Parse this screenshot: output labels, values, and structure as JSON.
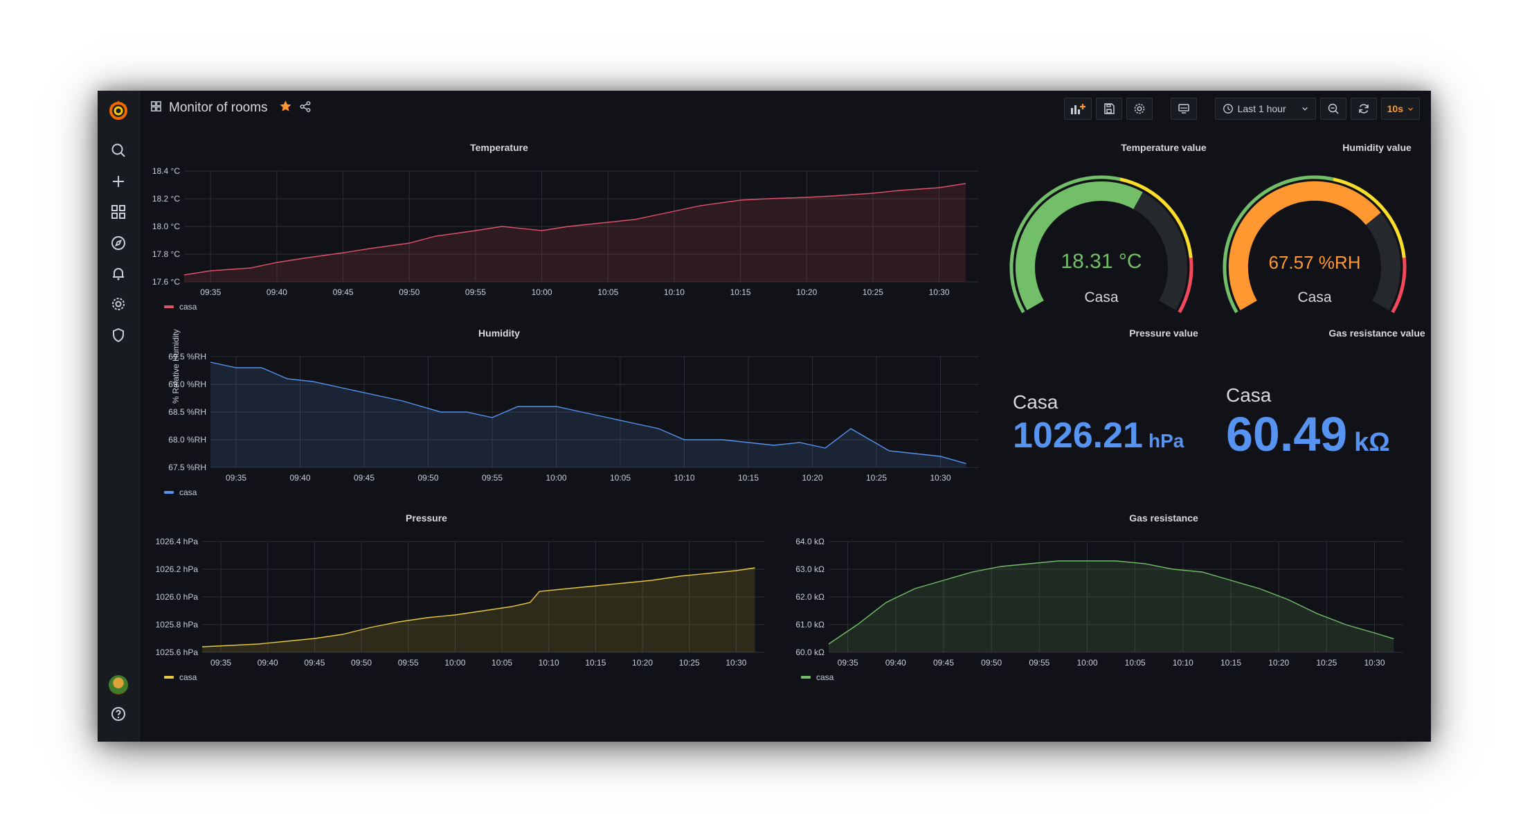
{
  "dashboard": {
    "title": "Monitor of rooms",
    "starred": true
  },
  "icons": {
    "logo": "grafana-logo-icon",
    "dashboard_grid": "dashboard-grid-icon",
    "star": "star-icon",
    "share": "share-icon",
    "sidebar": [
      "search-icon",
      "plus-icon",
      "dashboards-icon",
      "explore-icon",
      "alerting-bell-icon",
      "gear-icon",
      "shield-icon"
    ],
    "help": "help-icon"
  },
  "toolbar": {
    "time_range": "Last 1 hour",
    "refresh_interval": "10s",
    "buttons": [
      "add-panel-icon",
      "save-icon",
      "gear-icon",
      "tv-mode-icon",
      "clock-icon",
      "zoom-out-icon",
      "refresh-icon"
    ]
  },
  "colors": {
    "temperature": "#e0526c",
    "humidity": "#5794f2",
    "pressure": "#e8c83c",
    "gas": "#73bf69",
    "gauge_green": "#73bf69",
    "gauge_orange": "#ff9830",
    "gauge_yellow": "#fade2a",
    "gauge_red": "#f2495c",
    "stat_blue": "#5794f2"
  },
  "panels": {
    "temperature": {
      "title": "Temperature",
      "legend": "casa"
    },
    "humidity": {
      "title": "Humidity",
      "legend": "casa"
    },
    "pressure": {
      "title": "Pressure",
      "legend": "casa"
    },
    "gas": {
      "title": "Gas resistance",
      "legend": "casa"
    },
    "temperature_gauge": {
      "title": "Temperature value",
      "value": "18.31 °C",
      "label": "Casa",
      "fraction": 0.62
    },
    "humidity_gauge": {
      "title": "Humidity value",
      "value": "67.57 %RH",
      "label": "Casa",
      "fraction": 0.71
    },
    "pressure_stat": {
      "title": "Pressure value",
      "name": "Casa",
      "value": "1026.21",
      "unit": "hPa"
    },
    "gas_stat": {
      "title": "Gas resistance value",
      "name": "Casa",
      "value": "60.49",
      "unit": "kΩ"
    }
  },
  "chart_data": [
    {
      "type": "area",
      "title": "Temperature",
      "ylabel": "",
      "y_ticks": [
        "18.4 °C",
        "18.2 °C",
        "18.0 °C",
        "17.8 °C",
        "17.6 °C"
      ],
      "ylim": [
        17.6,
        18.4
      ],
      "x_ticks": [
        "09:35",
        "09:40",
        "09:45",
        "09:50",
        "09:55",
        "10:00",
        "10:05",
        "10:10",
        "10:15",
        "10:20",
        "10:25",
        "10:30"
      ],
      "x": [
        "09:33",
        "09:35",
        "09:38",
        "09:40",
        "09:42",
        "09:45",
        "09:47",
        "09:50",
        "09:52",
        "09:55",
        "09:57",
        "10:00",
        "10:02",
        "10:05",
        "10:07",
        "10:10",
        "10:12",
        "10:15",
        "10:17",
        "10:20",
        "10:22",
        "10:25",
        "10:27",
        "10:30",
        "10:32"
      ],
      "series": [
        {
          "name": "casa",
          "values": [
            17.65,
            17.68,
            17.7,
            17.74,
            17.77,
            17.81,
            17.84,
            17.88,
            17.93,
            17.97,
            18.0,
            17.97,
            18.0,
            18.03,
            18.05,
            18.11,
            18.15,
            18.19,
            18.2,
            18.21,
            18.22,
            18.24,
            18.26,
            18.28,
            18.31
          ]
        }
      ]
    },
    {
      "type": "area",
      "title": "Humidity",
      "ylabel": "% Relative Humidity",
      "y_ticks": [
        "69.5 %RH",
        "69.0 %RH",
        "68.5 %RH",
        "68.0 %RH",
        "67.5 %RH"
      ],
      "ylim": [
        67.5,
        69.5
      ],
      "x_ticks": [
        "09:35",
        "09:40",
        "09:45",
        "09:50",
        "09:55",
        "10:00",
        "10:05",
        "10:10",
        "10:15",
        "10:20",
        "10:25",
        "10:30"
      ],
      "x": [
        "09:33",
        "09:35",
        "09:37",
        "09:39",
        "09:41",
        "09:44",
        "09:46",
        "09:48",
        "09:51",
        "09:53",
        "09:55",
        "09:57",
        "10:00",
        "10:02",
        "10:04",
        "10:06",
        "10:08",
        "10:10",
        "10:13",
        "10:15",
        "10:17",
        "10:19",
        "10:21",
        "10:23",
        "10:26",
        "10:28",
        "10:30",
        "10:32"
      ],
      "series": [
        {
          "name": "casa",
          "values": [
            69.4,
            69.3,
            69.3,
            69.1,
            69.05,
            68.9,
            68.8,
            68.7,
            68.5,
            68.5,
            68.4,
            68.6,
            68.6,
            68.5,
            68.4,
            68.3,
            68.2,
            68.0,
            68.0,
            67.95,
            67.9,
            67.95,
            67.85,
            68.2,
            67.8,
            67.75,
            67.7,
            67.57
          ]
        }
      ]
    },
    {
      "type": "area",
      "title": "Pressure",
      "ylabel": "",
      "y_ticks": [
        "1026.4 hPa",
        "1026.2 hPa",
        "1026.0 hPa",
        "1025.8 hPa",
        "1025.6 hPa"
      ],
      "ylim": [
        1025.6,
        1026.4
      ],
      "x_ticks": [
        "09:35",
        "09:40",
        "09:45",
        "09:50",
        "09:55",
        "10:00",
        "10:05",
        "10:10",
        "10:15",
        "10:20",
        "10:25",
        "10:30"
      ],
      "x": [
        "09:33",
        "09:36",
        "09:39",
        "09:42",
        "09:45",
        "09:48",
        "09:51",
        "09:54",
        "09:57",
        "10:00",
        "10:03",
        "10:06",
        "10:08",
        "10:09",
        "10:12",
        "10:15",
        "10:18",
        "10:21",
        "10:24",
        "10:27",
        "10:30",
        "10:32"
      ],
      "series": [
        {
          "name": "casa",
          "values": [
            1025.64,
            1025.65,
            1025.66,
            1025.68,
            1025.7,
            1025.73,
            1025.78,
            1025.82,
            1025.85,
            1025.87,
            1025.9,
            1025.93,
            1025.96,
            1026.04,
            1026.06,
            1026.08,
            1026.1,
            1026.12,
            1026.15,
            1026.17,
            1026.19,
            1026.21
          ]
        }
      ]
    },
    {
      "type": "area",
      "title": "Gas resistance",
      "ylabel": "",
      "y_ticks": [
        "64.0 kΩ",
        "63.0 kΩ",
        "62.0 kΩ",
        "61.0 kΩ",
        "60.0 kΩ"
      ],
      "ylim": [
        60.0,
        64.0
      ],
      "x_ticks": [
        "09:35",
        "09:40",
        "09:45",
        "09:50",
        "09:55",
        "10:00",
        "10:05",
        "10:10",
        "10:15",
        "10:20",
        "10:25",
        "10:30"
      ],
      "x": [
        "09:33",
        "09:36",
        "09:39",
        "09:42",
        "09:45",
        "09:48",
        "09:51",
        "09:54",
        "09:57",
        "10:00",
        "10:03",
        "10:06",
        "10:09",
        "10:12",
        "10:15",
        "10:18",
        "10:21",
        "10:24",
        "10:27",
        "10:30",
        "10:32"
      ],
      "series": [
        {
          "name": "casa",
          "values": [
            60.3,
            61.0,
            61.8,
            62.3,
            62.6,
            62.9,
            63.1,
            63.2,
            63.3,
            63.3,
            63.3,
            63.2,
            63.0,
            62.9,
            62.6,
            62.3,
            61.9,
            61.4,
            61.0,
            60.7,
            60.49
          ]
        }
      ]
    }
  ]
}
